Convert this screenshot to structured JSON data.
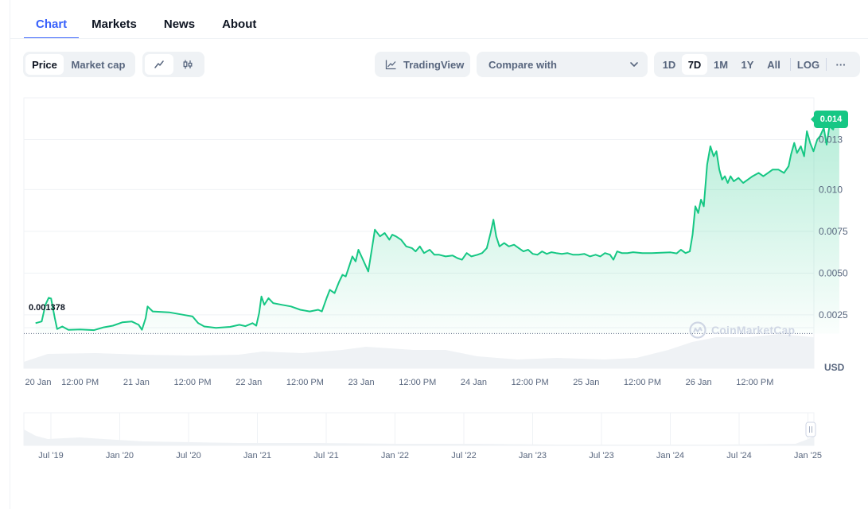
{
  "tabs": [
    {
      "label": "Chart",
      "active": true
    },
    {
      "label": "Markets",
      "active": false
    },
    {
      "label": "News",
      "active": false
    },
    {
      "label": "About",
      "active": false
    }
  ],
  "toolbar": {
    "metric_options": [
      {
        "label": "Price",
        "active": true
      },
      {
        "label": "Market cap",
        "active": false
      }
    ],
    "chart_style_icons": [
      "line-chart-icon",
      "candlestick-icon"
    ],
    "tradingview_label": "TradingView",
    "compare_label": "Compare with",
    "ranges": [
      {
        "label": "1D",
        "active": false
      },
      {
        "label": "7D",
        "active": true
      },
      {
        "label": "1M",
        "active": false
      },
      {
        "label": "1Y",
        "active": false
      },
      {
        "label": "All",
        "active": false
      }
    ],
    "log_label": "LOG",
    "more_label": "···"
  },
  "chart_data": {
    "type": "area",
    "currency": "USD",
    "current_price_label": "0.014",
    "baseline_label": "0.001378",
    "baseline_value": 0.001378,
    "y_ticks": [
      {
        "value": 0.013,
        "label": "0.013"
      },
      {
        "value": 0.01,
        "label": "0.010"
      },
      {
        "value": 0.0075,
        "label": "0.0075"
      },
      {
        "value": 0.005,
        "label": "0.0050"
      },
      {
        "value": 0.0025,
        "label": "0.0025"
      }
    ],
    "ylim": [
      -0.0007,
      0.0155
    ],
    "x_range_hours": [
      0,
      145
    ],
    "x_ticks": [
      {
        "hours": 0,
        "label": "20 Jan"
      },
      {
        "hours": 12,
        "label": "12:00 PM"
      },
      {
        "hours": 24,
        "label": "21 Jan"
      },
      {
        "hours": 36,
        "label": "12:00 PM"
      },
      {
        "hours": 48,
        "label": "22 Jan"
      },
      {
        "hours": 60,
        "label": "12:00 PM"
      },
      {
        "hours": 72,
        "label": "23 Jan"
      },
      {
        "hours": 84,
        "label": "12:00 PM"
      },
      {
        "hours": 96,
        "label": "24 Jan"
      },
      {
        "hours": 108,
        "label": "12:00 PM"
      },
      {
        "hours": 120,
        "label": "25 Jan"
      },
      {
        "hours": 132,
        "label": "12:00 PM"
      },
      {
        "hours": 144,
        "label": "26 Jan"
      },
      {
        "hours": 156,
        "label": "12:00 PM"
      }
    ],
    "price_series": [
      [
        2.5,
        0.002
      ],
      [
        3.8,
        0.0021
      ],
      [
        4.6,
        0.0031
      ],
      [
        5.3,
        0.00352
      ],
      [
        5.8,
        0.00348
      ],
      [
        6.6,
        0.0023
      ],
      [
        7.1,
        0.00165
      ],
      [
        8.2,
        0.0018
      ],
      [
        9.5,
        0.0016
      ],
      [
        12,
        0.00162
      ],
      [
        15,
        0.00158
      ],
      [
        17,
        0.00175
      ],
      [
        19,
        0.00185
      ],
      [
        21,
        0.00205
      ],
      [
        23,
        0.0021
      ],
      [
        24.5,
        0.0019
      ],
      [
        25.2,
        0.0016
      ],
      [
        26,
        0.0023
      ],
      [
        26.4,
        0.003
      ],
      [
        27.5,
        0.0027
      ],
      [
        31,
        0.00265
      ],
      [
        34,
        0.0025
      ],
      [
        36,
        0.0024
      ],
      [
        37.2,
        0.002
      ],
      [
        38.5,
        0.0018
      ],
      [
        41,
        0.00172
      ],
      [
        44,
        0.00178
      ],
      [
        46,
        0.0019
      ],
      [
        47.3,
        0.00182
      ],
      [
        48.8,
        0.002
      ],
      [
        49.6,
        0.00185
      ],
      [
        50.2,
        0.0026
      ],
      [
        50.7,
        0.0036
      ],
      [
        51.3,
        0.0031
      ],
      [
        52.2,
        0.0035
      ],
      [
        53.2,
        0.0032
      ],
      [
        55,
        0.0031
      ],
      [
        57,
        0.003
      ],
      [
        59,
        0.0028
      ],
      [
        61,
        0.0027
      ],
      [
        62.8,
        0.0028
      ],
      [
        63.6,
        0.0027
      ],
      [
        64.6,
        0.0035
      ],
      [
        65.3,
        0.004
      ],
      [
        66.3,
        0.0038
      ],
      [
        67.3,
        0.0045
      ],
      [
        68,
        0.0049
      ],
      [
        68.7,
        0.0048
      ],
      [
        69.4,
        0.0054
      ],
      [
        70.1,
        0.006
      ],
      [
        70.8,
        0.0057
      ],
      [
        71.4,
        0.0064
      ],
      [
        72.2,
        0.0059
      ],
      [
        73.5,
        0.0051
      ],
      [
        74.3,
        0.0065
      ],
      [
        74.9,
        0.0076
      ],
      [
        76,
        0.0072
      ],
      [
        77,
        0.0074
      ],
      [
        78,
        0.007
      ],
      [
        78.6,
        0.0073
      ],
      [
        79.4,
        0.0072
      ],
      [
        80.5,
        0.007
      ],
      [
        81.6,
        0.0066
      ],
      [
        82.8,
        0.0065
      ],
      [
        83.6,
        0.0063
      ],
      [
        84.5,
        0.0066
      ],
      [
        85.4,
        0.0062
      ],
      [
        86.6,
        0.0064
      ],
      [
        87.6,
        0.0061
      ],
      [
        88.6,
        0.0061
      ],
      [
        90,
        0.006
      ],
      [
        91.5,
        0.00605
      ],
      [
        92.5,
        0.0059
      ],
      [
        93.5,
        0.0058
      ],
      [
        94.5,
        0.0062
      ],
      [
        95.5,
        0.006
      ],
      [
        96.8,
        0.0061
      ],
      [
        97.8,
        0.0062
      ],
      [
        98.8,
        0.0065
      ],
      [
        99.6,
        0.0074
      ],
      [
        100.2,
        0.0082
      ],
      [
        100.8,
        0.0072
      ],
      [
        101.5,
        0.0066
      ],
      [
        102.5,
        0.0068
      ],
      [
        103.5,
        0.0066
      ],
      [
        104.6,
        0.0067
      ],
      [
        105.6,
        0.0065
      ],
      [
        106.6,
        0.0063
      ],
      [
        107.6,
        0.0064
      ],
      [
        108.6,
        0.00615
      ],
      [
        109.6,
        0.0061
      ],
      [
        110.6,
        0.0063
      ],
      [
        111.6,
        0.00615
      ],
      [
        112.6,
        0.00625
      ],
      [
        113.6,
        0.0062
      ],
      [
        114.8,
        0.00615
      ],
      [
        116,
        0.0062
      ],
      [
        117.2,
        0.0061
      ],
      [
        118.4,
        0.0061
      ],
      [
        119.6,
        0.00615
      ],
      [
        120.8,
        0.006
      ],
      [
        122,
        0.0061
      ],
      [
        123,
        0.006
      ],
      [
        124,
        0.0062
      ],
      [
        125.1,
        0.0061
      ],
      [
        125.8,
        0.0058
      ],
      [
        126.6,
        0.0063
      ],
      [
        127.6,
        0.0062
      ],
      [
        128.8,
        0.0062
      ],
      [
        130,
        0.00625
      ],
      [
        132,
        0.0062
      ],
      [
        134,
        0.0062
      ],
      [
        136,
        0.00622
      ],
      [
        138,
        0.00624
      ],
      [
        139.3,
        0.00618
      ],
      [
        140.2,
        0.0064
      ],
      [
        141.2,
        0.0062
      ],
      [
        142.1,
        0.0063
      ],
      [
        142.7,
        0.0073
      ],
      [
        143.3,
        0.009
      ],
      [
        143.9,
        0.0086
      ],
      [
        144.5,
        0.0094
      ],
      [
        145.1,
        0.009
      ],
      [
        145.8,
        0.0115
      ],
      [
        146.5,
        0.0126
      ],
      [
        147.2,
        0.012
      ],
      [
        147.8,
        0.0123
      ],
      [
        148.4,
        0.0112
      ],
      [
        149,
        0.0106
      ],
      [
        149.6,
        0.0108
      ],
      [
        150.2,
        0.0104
      ],
      [
        150.8,
        0.0108
      ],
      [
        151.5,
        0.0105
      ],
      [
        152.5,
        0.0107
      ],
      [
        153.5,
        0.0104
      ],
      [
        154.5,
        0.0106
      ],
      [
        155.5,
        0.0108
      ],
      [
        156.8,
        0.011
      ],
      [
        157.8,
        0.0108
      ],
      [
        158.8,
        0.011
      ],
      [
        159.8,
        0.0112
      ],
      [
        161,
        0.0112
      ],
      [
        162.2,
        0.011
      ],
      [
        163.2,
        0.0114
      ],
      [
        163.7,
        0.0121
      ],
      [
        164.4,
        0.0128
      ],
      [
        165,
        0.0122
      ],
      [
        165.8,
        0.0126
      ],
      [
        166.5,
        0.012
      ],
      [
        167.1,
        0.0135
      ],
      [
        167.8,
        0.0128
      ],
      [
        168.5,
        0.0123
      ],
      [
        169.3,
        0.013
      ],
      [
        169.9,
        0.0132
      ],
      [
        170.7,
        0.0137
      ],
      [
        171.3,
        0.0127
      ],
      [
        171.9,
        0.0138
      ],
      [
        172.7,
        0.0136
      ],
      [
        173.4,
        0.0144
      ],
      [
        174,
        0.014
      ]
    ],
    "x_series_end_hours": 174,
    "volume_series_hint": "background volume area",
    "navigator": {
      "x_ticks": [
        "Jul '19",
        "Jan '20",
        "Jul '20",
        "Jan '21",
        "Jul '21",
        "Jan '22",
        "Jul '22",
        "Jan '23",
        "Jul '23",
        "Jan '24",
        "Jul '24",
        "Jan '25"
      ]
    },
    "watermark": "CoinMarketCap"
  }
}
